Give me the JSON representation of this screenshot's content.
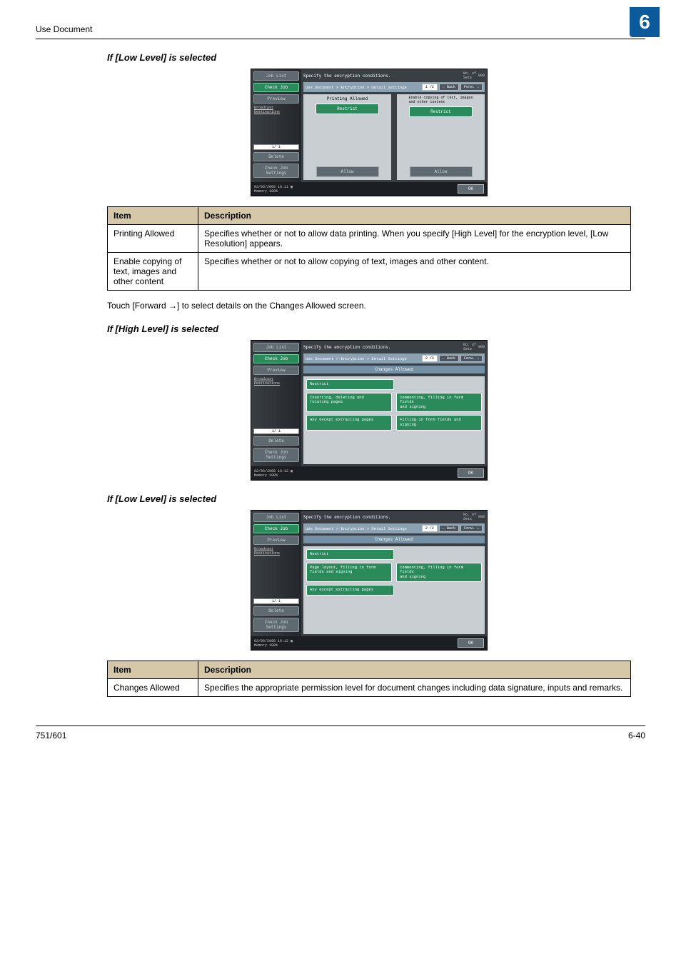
{
  "header": {
    "breadcrumb": "Use Document",
    "chapter": "6"
  },
  "sections": {
    "s1_title": "If [Low Level] is selected",
    "s2_text": "Touch [Forward →] to select details on the Changes Allowed screen.",
    "s2_title": "If [High Level] is selected",
    "s3_title": "If [Low Level] is selected"
  },
  "table1": {
    "h_item": "Item",
    "h_desc": "Description",
    "rows": [
      {
        "item": "Printing Allowed",
        "desc": "Specifies whether or not to allow data printing. When you specify [High Level] for the encryption level, [Low Resolution] appears."
      },
      {
        "item": "Enable copying of text, images and other content",
        "desc": "Specifies whether or not to allow copying of text, images and other content."
      }
    ]
  },
  "table2": {
    "h_item": "Item",
    "h_desc": "Description",
    "rows": [
      {
        "item": "Changes Allowed",
        "desc": "Specifies the appropriate permission level for document changes including data signature, inputs and remarks."
      }
    ]
  },
  "shot_common": {
    "job_list": "Job List",
    "check_job": "Check Job",
    "preview": "Preview",
    "broadcast": "Broadcast\nDestinations",
    "page_mini": "1/  1",
    "delete": "Delete",
    "check_set": "Check Job\nSettings",
    "instr": "Specify the encryption conditions.",
    "no_sets": "No. of\nSets",
    "no_sets_v": "800",
    "crumb": "Use Document > Encryption > Detail Settings",
    "back": "Back",
    "forw": "Forw.",
    "dt": "02/06/2008   16:11",
    "mem": "Memory        100%",
    "ok": "OK"
  },
  "shot1": {
    "pg": "1 /2",
    "col1_head": "Printing Allowed",
    "col2_head": "Enable copying of text, images\nand other content",
    "restrict": "Restrict",
    "allow": "Allow"
  },
  "shot2": {
    "pg": "2 /2",
    "sub": "Changes Allowed",
    "dt": "02/06/2008   16:12",
    "restrict": "Restrict",
    "o1": "Inserting, deleting and\nrotating pages",
    "o2": "Commenting, filling in form fields\nand signing",
    "o3": "Any except extracting pages",
    "o4": "Filling in form fields and\nsigning"
  },
  "shot3": {
    "pg": "2 /2",
    "sub": "Changes Allowed",
    "dt": "02/06/2008   16:12",
    "restrict": "Restrict",
    "o1": "Page layout, filling in form\nfields and signing",
    "o2": "Commenting, filling in form fields\nand signing",
    "o3": "Any except extracting pages"
  },
  "footer": {
    "left": "751/601",
    "right": "6-40"
  }
}
